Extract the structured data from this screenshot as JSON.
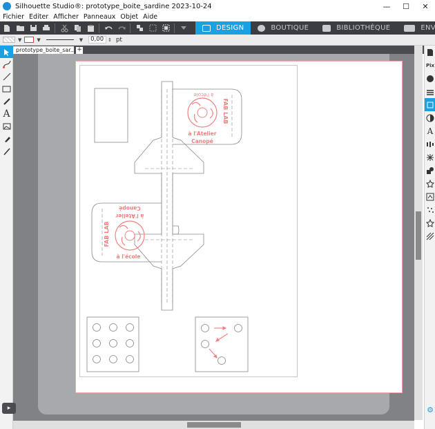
{
  "window": {
    "title": "Silhouette Studio®: prototype_boite_sardine 2023-10-24",
    "controls": {
      "minimize": "—",
      "maximize": "☐",
      "close": "✕"
    }
  },
  "menu": [
    "Fichier",
    "Editer",
    "Afficher",
    "Panneaux",
    "Objet",
    "Aide"
  ],
  "mode_tabs": [
    {
      "label": "DESIGN",
      "active": true
    },
    {
      "label": "BOUTIQUE",
      "active": false
    },
    {
      "label": "BIBLIOTHÈQUE",
      "active": false
    },
    {
      "label": "ENVOYER",
      "active": false
    }
  ],
  "line_settings": {
    "width_value": "0,00",
    "unit": "pt"
  },
  "document_tab": {
    "name": "prototype_boite_sar...",
    "close": "×",
    "add": "+"
  },
  "design": {
    "logo_text": "FAB LAB",
    "caption_line1": "à l'Atelier",
    "caption_line2": "Canopé",
    "top_label": "à l'école",
    "bottom_label": "à l'école",
    "accent_color": "#f08080",
    "cut_color": "#888888"
  },
  "colors": {
    "accent": "#1aa1e2",
    "toolbar_bg": "#3b3d42",
    "mat": "#a7a9ac",
    "workspace": "#808285"
  }
}
